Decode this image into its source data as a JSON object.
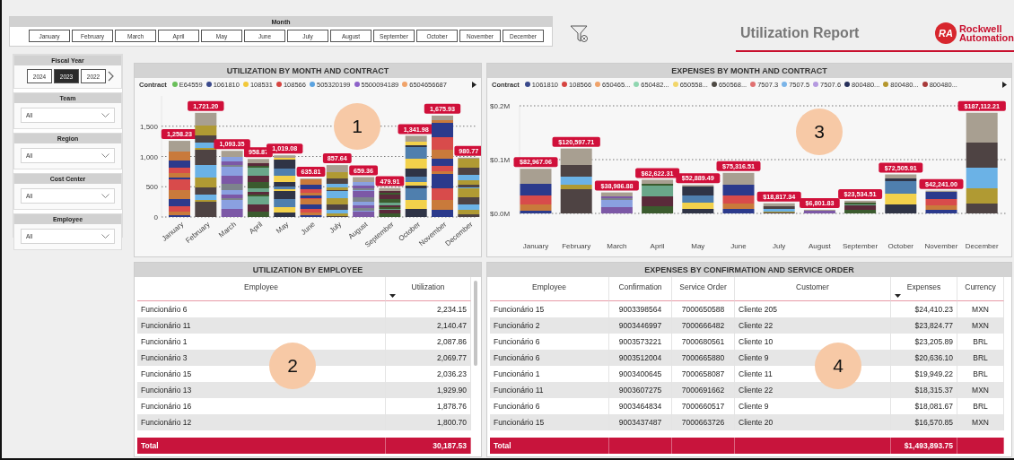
{
  "month_slicer": {
    "title": "Month",
    "items": [
      {
        "label": "January",
        "selected": false
      },
      {
        "label": "February",
        "selected": false
      },
      {
        "label": "March",
        "selected": false
      },
      {
        "label": "April",
        "selected": false
      },
      {
        "label": "May",
        "selected": false
      },
      {
        "label": "June",
        "selected": false
      },
      {
        "label": "July",
        "selected": false
      },
      {
        "label": "August",
        "selected": false
      },
      {
        "label": "September",
        "selected": false
      },
      {
        "label": "October",
        "selected": false
      },
      {
        "label": "November",
        "selected": false
      },
      {
        "label": "December",
        "selected": false
      }
    ]
  },
  "header": {
    "title": "Utilization Report",
    "logo": {
      "mark": "RA",
      "line1": "Rockwell",
      "line2": "Automation"
    }
  },
  "filters": {
    "fiscal_year": {
      "title": "Fiscal Year",
      "items": [
        {
          "label": "2024",
          "selected": false
        },
        {
          "label": "2023",
          "selected": true
        },
        {
          "label": "2022",
          "selected": false
        }
      ]
    },
    "dropdowns": [
      {
        "title": "Team",
        "value": "All"
      },
      {
        "title": "Region",
        "value": "All"
      },
      {
        "title": "Cost Center",
        "value": "All"
      },
      {
        "title": "Employee",
        "value": "All"
      }
    ]
  },
  "utilization_chart": {
    "title": "UTILIZATION BY MONTH AND CONTRACT",
    "callout": "1",
    "legend_title": "Contract",
    "legend": [
      {
        "label": "E64559",
        "color": "#6abf5a"
      },
      {
        "label": "1061810",
        "color": "#3b4a8c"
      },
      {
        "label": "108531",
        "color": "#f2c83a"
      },
      {
        "label": "108566",
        "color": "#d64541"
      },
      {
        "label": "505320199",
        "color": "#5ba3e0"
      },
      {
        "label": "5500094189",
        "color": "#8e63c9"
      },
      {
        "label": "6504656687",
        "color": "#f0a36a"
      }
    ],
    "chart_data": {
      "type": "bar",
      "stacked": true,
      "categories": [
        "January",
        "February",
        "March",
        "April",
        "May",
        "June",
        "July",
        "August",
        "September",
        "October",
        "November",
        "December"
      ],
      "values": [
        1258.23,
        1721.2,
        1093.35,
        958.87,
        1019.08,
        635.81,
        857.64,
        659.36,
        479.91,
        1341.98,
        1675.93,
        980.77
      ],
      "value_labels": [
        "1,258.23",
        "1,721.20",
        "1,093.35",
        "958.87",
        "1,019.08",
        "635.81",
        "857.64",
        "659.36",
        "479.91",
        "1,341.98",
        "1,675.93",
        "980.77"
      ],
      "grid": true,
      "ylim": [
        0,
        2000
      ],
      "yticks": [
        {
          "value": 0,
          "label": "0"
        },
        {
          "value": 500,
          "label": "500"
        },
        {
          "value": 1000,
          "label": "1,000"
        },
        {
          "value": 1500,
          "label": "1,500"
        }
      ]
    }
  },
  "expenses_chart": {
    "title": "EXPENSES BY MONTH AND CONTRACT",
    "callout": "3",
    "legend_title": "Contract",
    "legend": [
      {
        "label": "1061810",
        "color": "#3b4a8c"
      },
      {
        "label": "108566",
        "color": "#d64541"
      },
      {
        "label": "650465...",
        "color": "#f0a36a"
      },
      {
        "label": "650482...",
        "color": "#8fd6b0"
      },
      {
        "label": "650558...",
        "color": "#f2d66a"
      },
      {
        "label": "650568...",
        "color": "#4e4a44"
      },
      {
        "label": "7507.3",
        "color": "#e07070"
      },
      {
        "label": "7507.5",
        "color": "#7ab4e8"
      },
      {
        "label": "7507.6",
        "color": "#b59ae0"
      },
      {
        "label": "800480...",
        "color": "#27305a"
      },
      {
        "label": "800480...",
        "color": "#b5972e"
      },
      {
        "label": "800480...",
        "color": "#a83a3a"
      }
    ],
    "chart_data": {
      "type": "bar",
      "stacked": true,
      "categories": [
        "January",
        "February",
        "March",
        "April",
        "May",
        "June",
        "July",
        "August",
        "September",
        "October",
        "November",
        "December"
      ],
      "values": [
        82967.06,
        120597.71,
        38986.88,
        62622.31,
        52889.49,
        75316.51,
        18817.34,
        6801.83,
        23534.51,
        72505.91,
        42241.0,
        187112.21
      ],
      "value_labels": [
        "$82,967.06",
        "$120,597.71",
        "$38,986.88",
        "$62,622.31",
        "$52,889.49",
        "$75,316.51",
        "$18,817.34",
        "$6,801.83",
        "$23,534.51",
        "$72,505.91",
        "$42,241.00",
        "$187,112.21"
      ],
      "grid": true,
      "ylim": [
        0,
        200000
      ],
      "yticks": [
        {
          "value": 0,
          "label": "$0.0M"
        },
        {
          "value": 100000,
          "label": "$0.1M"
        },
        {
          "value": 200000,
          "label": "$0.2M"
        }
      ]
    }
  },
  "employee_table": {
    "title": "UTILIZATION BY EMPLOYEE",
    "callout": "2",
    "columns": [
      {
        "label": "Employee",
        "sorted": false
      },
      {
        "label": "Utilization",
        "sorted": true
      }
    ],
    "rows": [
      [
        "Funcionário 6",
        "2,234.15"
      ],
      [
        "Funcionário 11",
        "2,140.47"
      ],
      [
        "Funcionário 1",
        "2,087.86"
      ],
      [
        "Funcionário 3",
        "2,069.77"
      ],
      [
        "Funcionário 15",
        "2,036.23"
      ],
      [
        "Funcionário 13",
        "1,929.90"
      ],
      [
        "Funcionário 16",
        "1,878.76"
      ],
      [
        "Funcionário 12",
        "1,800.70"
      ]
    ],
    "total": {
      "label": "Total",
      "value": "30,187.53"
    }
  },
  "expenses_table": {
    "title": "EXPENSES BY CONFIRMATION AND SERVICE ORDER",
    "callout": "4",
    "columns": [
      {
        "label": "Employee",
        "sorted": false
      },
      {
        "label": "Confirmation",
        "sorted": false
      },
      {
        "label": "Service Order",
        "sorted": false
      },
      {
        "label": "Customer",
        "sorted": false
      },
      {
        "label": "Expenses",
        "sorted": true
      },
      {
        "label": "Currency",
        "sorted": false
      }
    ],
    "rows": [
      [
        "Funcionário 15",
        "9003398564",
        "7000650588",
        "Cliente 205",
        "$24,410.23",
        "MXN"
      ],
      [
        "Funcionário 2",
        "9003446997",
        "7000666482",
        "Cliente 22",
        "$23,824.77",
        "MXN"
      ],
      [
        "Funcionário 6",
        "9003573221",
        "7000680561",
        "Cliente 10",
        "$23,205.89",
        "BRL"
      ],
      [
        "Funcionário 6",
        "9003512004",
        "7000665880",
        "Cliente 9",
        "$20,636.10",
        "BRL"
      ],
      [
        "Funcionário 1",
        "9003400645",
        "7000658087",
        "Cliente 11",
        "$19,949.22",
        "BRL"
      ],
      [
        "Funcionário 11",
        "9003607275",
        "7000691662",
        "Cliente 22",
        "$18,315.37",
        "MXN"
      ],
      [
        "Funcionário 6",
        "9003464834",
        "7000660517",
        "Cliente 9",
        "$18,081.67",
        "BRL"
      ],
      [
        "Funcionário 15",
        "9003437487",
        "7000663726",
        "Cliente 20",
        "$16,570.85",
        "MXN"
      ]
    ],
    "total": {
      "label": "Total",
      "value": "$1,493,893.75"
    }
  }
}
